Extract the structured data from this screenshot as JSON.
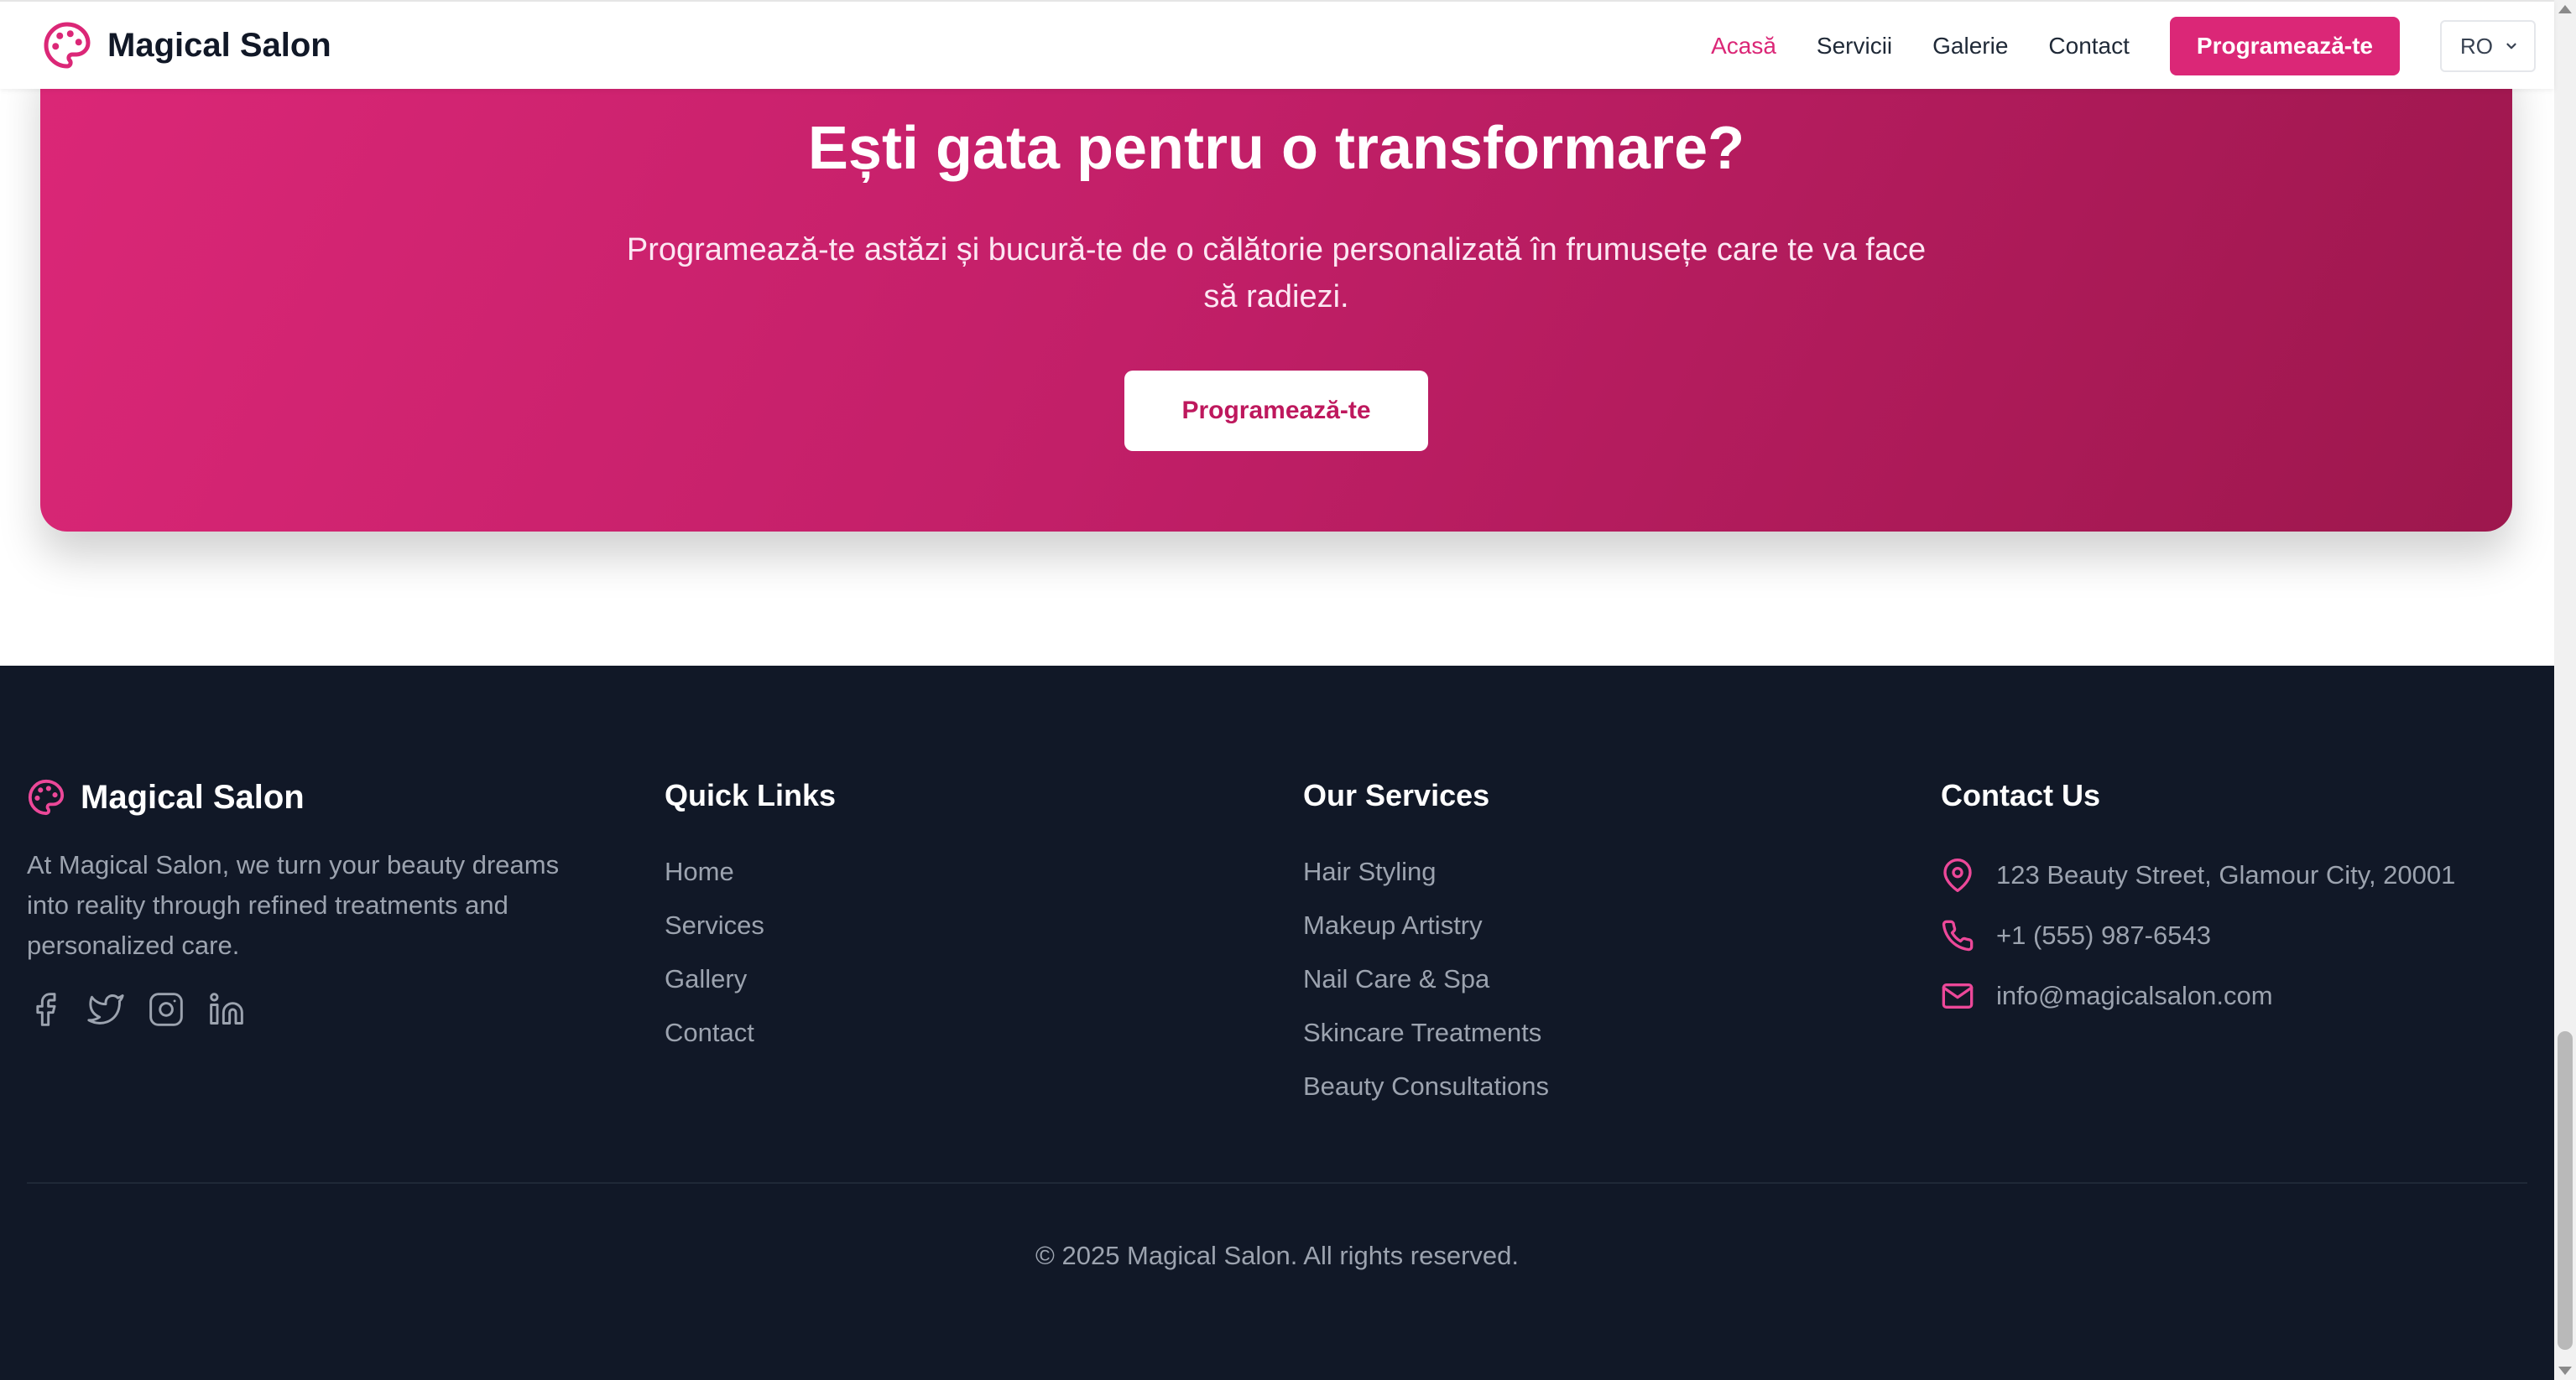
{
  "header": {
    "brand": "Magical Salon",
    "nav": [
      "Acasă",
      "Servicii",
      "Galerie",
      "Contact"
    ],
    "active_index": 0,
    "book_label": "Programează-te",
    "language": "RO",
    "brand_color": "#db2777"
  },
  "cta": {
    "title": "Ești gata pentru o transformare?",
    "text": "Programează-te astăzi și bucură-te de o călătorie personalizată în frumusețe care te va face să radiezi.",
    "button": "Programează-te"
  },
  "footer": {
    "brand": "Magical Salon",
    "description": "At Magical Salon, we turn your beauty dreams into reality through refined treatments and personalized care.",
    "socials": [
      "facebook-icon",
      "twitter-icon",
      "instagram-icon",
      "linkedin-icon"
    ],
    "quick_links": {
      "title": "Quick Links",
      "items": [
        "Home",
        "Services",
        "Gallery",
        "Contact"
      ]
    },
    "services": {
      "title": "Our Services",
      "items": [
        "Hair Styling",
        "Makeup Artistry",
        "Nail Care & Spa",
        "Skincare Treatments",
        "Beauty Consultations"
      ]
    },
    "contact": {
      "title": "Contact Us",
      "address": "123 Beauty Street, Glamour City, 20001",
      "phone": "+1 (555) 987-6543",
      "email": "info@magicalsalon.com"
    },
    "copyright": "© 2025 Magical Salon. All rights reserved.",
    "background": "#111827"
  }
}
